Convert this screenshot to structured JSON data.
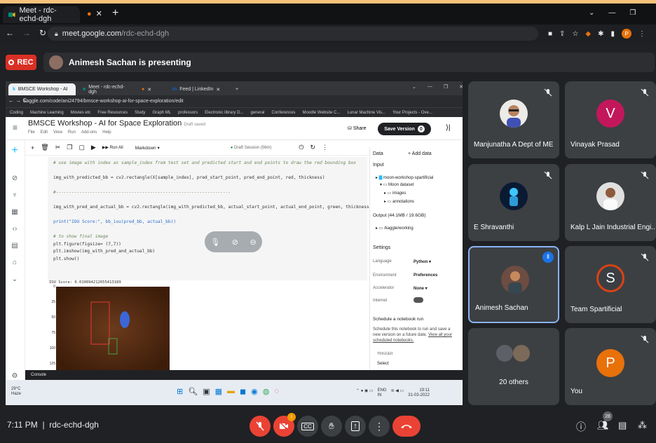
{
  "browser": {
    "tab_title": "Meet - rdc-echd-dgh",
    "url_domain": "meet.google.com",
    "url_path": "/rdc-echd-dgh",
    "profile_letter": "P"
  },
  "meet": {
    "rec_label": "REC",
    "presenting_text": "Animesh Sachan is presenting",
    "time": "7:11 PM",
    "meeting_code": "rdc-echd-dgh",
    "people_count": "28",
    "camera_badge": "!"
  },
  "shared": {
    "tabs": [
      "BMSCE Workshop - AI for Space",
      "Meet - rdc-echd-dgh",
      "",
      "Feed | LinkedIn"
    ],
    "url": "kaggle.com/code/ani24794/bmsce-workshop-ai-for-space-exploration/edit",
    "bookmarks": [
      "Coding",
      "Machine Learning",
      "Movies etc",
      "Free Resources",
      "Study",
      "Graph ML",
      "professors",
      "Electronic library D...",
      "general",
      "Conferences",
      "Moodle Website C...",
      "Lunar Machine Vis...",
      "Your Projects - Ove..."
    ],
    "title": "BMSCE Workshop - AI for Space Exploration",
    "draft": "Draft saved",
    "menu": [
      "File",
      "Edit",
      "View",
      "Run",
      "Add-ons",
      "Help"
    ],
    "share": "Share",
    "save_version": "Save Version",
    "save_count": "0",
    "run_all": "Run All",
    "cell_type": "Markdown",
    "session": "Draft Session (56m)",
    "code_lines": {
      "c1": "# use image with index as sample_index from test set and predicted start and end points to draw the red bounding box",
      "l1": "img_with_predicted_bb = cv2.rectangle(X[sample_index], pred_start_point, pred_end_point, red, thickness)",
      "l2": "#-------------------------------------------------------------------",
      "l3": "img_with_pred_and_actual_bb = cv2.rectangle(img_with_predicted_bb, actual_start_point, actual_end_point, green, thickness)",
      "l4": "print(\"IOU Score:\", bb_iou(pred_bb, actual_bb))",
      "c2": "# to show final image",
      "l5": "plt.figure(figsize= (7,7))",
      "l6": "plt.imshow(img_with_pred_and_actual_bb)",
      "l7": "plt.show()"
    },
    "iou_output": "IOU Score: 0.010094212655413189",
    "plot_ticks": [
      "0",
      "25",
      "50",
      "75",
      "100",
      "125"
    ],
    "console": "Console",
    "panel": {
      "data": "Data",
      "add_data": "+ Add data",
      "input": "Input",
      "ds_root": "moon-workshop-spartificial",
      "ds1": "Moon dataset",
      "ds2": "images",
      "ds3": "annotations",
      "output": "Output (44.1MB / 19.6GB)",
      "out1": "/kaggle/working",
      "settings": "Settings",
      "lang_k": "Language",
      "lang_v": "Python",
      "env_k": "Environment",
      "env_v": "Preferences",
      "acc_k": "Accelerator",
      "acc_v": "None",
      "net_k": "Internet",
      "schedule": "Schedule a notebook run",
      "schedule_desc": "Schedule this notebook to run and save a new version on a future date.",
      "schedule_link": "View all your scheduled notebooks.",
      "trigger": "TRIGGER",
      "select": "Select"
    },
    "taskbar": {
      "weather_temp": "29°C",
      "weather_desc": "Haze",
      "lang1": "ENG",
      "lang2": "IN",
      "clock_time": "19:11",
      "clock_date": "31-03-2022"
    }
  },
  "participants": [
    {
      "name": "Manjunatha A Dept of ME",
      "type": "photo",
      "muted": true
    },
    {
      "name": "Vinayak Prasad",
      "type": "letter",
      "letter": "V",
      "color": "#c2185b",
      "muted": true
    },
    {
      "name": "E Shravanthi",
      "type": "photo",
      "muted": true
    },
    {
      "name": "Kalp L Jain Industrial Engi...",
      "type": "photo",
      "muted": true
    },
    {
      "name": "Animesh Sachan",
      "type": "photo",
      "muted": false,
      "speaking": true
    },
    {
      "name": "Team Spartificial",
      "type": "letter",
      "letter": "S",
      "muted": true
    },
    {
      "name": "20 others",
      "type": "group",
      "muted": false
    },
    {
      "name": "You",
      "type": "letter",
      "letter": "P",
      "color": "#e8710a",
      "muted": true
    }
  ],
  "colors": {
    "accent": "#8ab4f8",
    "end_call": "#ea4335",
    "rec": "#d93025"
  }
}
